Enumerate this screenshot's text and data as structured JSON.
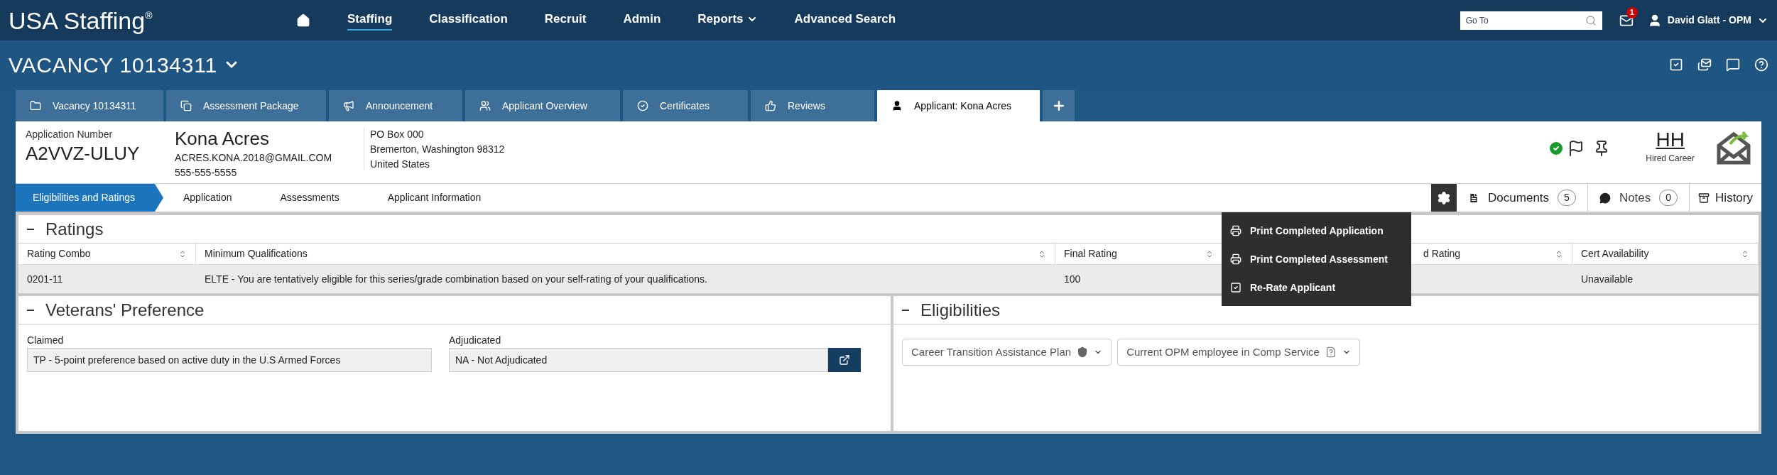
{
  "header": {
    "logo": "USA Staffing",
    "logo_mark": "®",
    "nav": [
      {
        "kind": "home",
        "selected": false
      },
      {
        "kind": "link",
        "label": "Staffing",
        "selected": true
      },
      {
        "kind": "link",
        "label": "Classification",
        "selected": false
      },
      {
        "kind": "link",
        "label": "Recruit",
        "selected": false
      },
      {
        "kind": "link",
        "label": "Admin",
        "selected": false
      },
      {
        "kind": "dropdown",
        "label": "Reports",
        "selected": false
      },
      {
        "kind": "link",
        "label": "Advanced Search",
        "selected": false
      }
    ],
    "search": {
      "placeholder": "Go To"
    },
    "mail_badge": "1",
    "user": "David Glatt - OPM"
  },
  "vacancy_title": "VACANCY 10134311",
  "tabs": [
    {
      "kind": "folder",
      "label": "Vacancy 10134311",
      "selected": false
    },
    {
      "kind": "copy",
      "label": "Assessment Package",
      "selected": false
    },
    {
      "kind": "megaphone",
      "label": "Announcement",
      "selected": false
    },
    {
      "kind": "users",
      "label": "Applicant Overview",
      "selected": false
    },
    {
      "kind": "check",
      "label": "Certificates",
      "selected": false
    },
    {
      "kind": "thumb",
      "label": "Reviews",
      "selected": false
    },
    {
      "kind": "user",
      "label": "Applicant: Kona Acres",
      "selected": true
    }
  ],
  "applicant": {
    "number_label": "Application Number",
    "number": "A2VVZ-ULUY",
    "name": "Kona Acres",
    "email": "ACRES.KONA.2018@GMAIL.COM",
    "phone": "555-555-5555",
    "address": [
      "PO Box 000",
      "Bremerton, Washington 98312",
      "United States"
    ],
    "status_code": "HH",
    "status_label": "Hired Career"
  },
  "steps": [
    {
      "label": "Eligibilities and Ratings",
      "selected": true
    },
    {
      "label": "Application",
      "selected": false
    },
    {
      "label": "Assessments",
      "selected": false
    },
    {
      "label": "Applicant Information",
      "selected": false
    }
  ],
  "toolbar": {
    "documents": "Documents",
    "documents_count": "5",
    "notes": "Notes",
    "notes_count": "0",
    "history": "History"
  },
  "menu": [
    {
      "kind": "print",
      "label": "Print Completed Application"
    },
    {
      "kind": "print",
      "label": "Print Completed Assessment"
    },
    {
      "kind": "check",
      "label": "Re-Rate Applicant"
    }
  ],
  "ratings": {
    "title": "Ratings",
    "columns": [
      "Rating Combo",
      "Minimum Qualifications",
      "Final Rating",
      "d Rating",
      "Cert Availability"
    ],
    "rows": [
      [
        "0201-11",
        "ELTE - You are tentatively eligible for this series/grade combination based on your self-rating of your qualifications.",
        "100",
        "",
        "Unavailable"
      ]
    ]
  },
  "veterans": {
    "title": "Veterans' Preference",
    "claimed_label": "Claimed",
    "claimed": "TP - 5-point preference based on active duty in the U.S Armed Forces",
    "adjudicated_label": "Adjudicated",
    "adjudicated": "NA - Not Adjudicated"
  },
  "eligibilities": {
    "title": "Eligibilities",
    "chips": [
      {
        "kind": "shield",
        "label": "Career Transition Assistance Plan"
      },
      {
        "kind": "question",
        "label": "Current OPM employee in Comp Service"
      }
    ]
  }
}
